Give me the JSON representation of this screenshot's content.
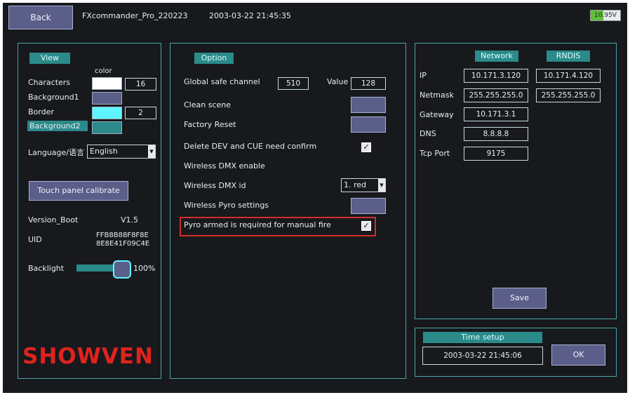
{
  "header": {
    "back_label": "Back",
    "app_title": "FXcommander_Pro_220223",
    "datetime": "2003-03-22 21:45:35",
    "battery": "10.95V"
  },
  "view": {
    "tab": "View",
    "color_header": "color",
    "characters_label": "Characters",
    "characters_value": "16",
    "background1_label": "Background1",
    "border_label": "Border",
    "border_value": "2",
    "background2_label": "Background2",
    "language_label": "Language/语言",
    "language_value": "English",
    "calibrate_label": "Touch panel calibrate",
    "version_label": "Version_Boot",
    "version_value": "V1.5",
    "uid_label": "UID",
    "uid_line1": "FFB8B88F8F8E",
    "uid_line2": "8E8E41F09C4E",
    "backlight_label": "Backlight",
    "backlight_value": "100%",
    "backlight_level": 1.0,
    "logo_text": "SHOWVEN"
  },
  "option": {
    "tab": "Option",
    "global_safe_label": "Global safe channel",
    "global_safe_value": "510",
    "value_label": "Value",
    "value_value": "128",
    "clean_scene_label": "Clean scene",
    "factory_reset_label": "Factory Reset",
    "delete_confirm_label": "Delete DEV and CUE need confirm",
    "delete_confirm_checked": true,
    "wireless_dmx_enable_label": "Wireless DMX enable",
    "wireless_dmx_id_label": "Wireless DMX id",
    "wireless_dmx_id_value": "1. red",
    "wireless_pyro_label": "Wireless Pyro settings",
    "pyro_armed_label": "Pyro armed is required for manual fire",
    "pyro_armed_checked": true
  },
  "network": {
    "network_tab": "Network",
    "rndis_tab": "RNDIS",
    "ip_label": "IP",
    "ip_value": "10.171.3.120",
    "rndis_ip_value": "10.171.4.120",
    "netmask_label": "Netmask",
    "netmask_value": "255.255.255.0",
    "rndis_netmask_value": "255.255.255.0",
    "gateway_label": "Gateway",
    "gateway_value": "10.171.3.1",
    "dns_label": "DNS",
    "dns_value": "8.8.8.8",
    "tcp_port_label": "Tcp Port",
    "tcp_port_value": "9175",
    "save_label": "Save"
  },
  "time_setup": {
    "tab": "Time setup",
    "value": "2003-03-22 21:45:06",
    "ok_label": "OK"
  },
  "colors": {
    "panel_border": "#4aa6a6",
    "tab_bg": "#2b8a8a",
    "button_bg": "#5a5e88",
    "highlight_red": "#d0302a",
    "logo_red": "#e0231d",
    "cyan_swatch": "#5ff5ff",
    "battery_green": "#5fbf3a"
  }
}
